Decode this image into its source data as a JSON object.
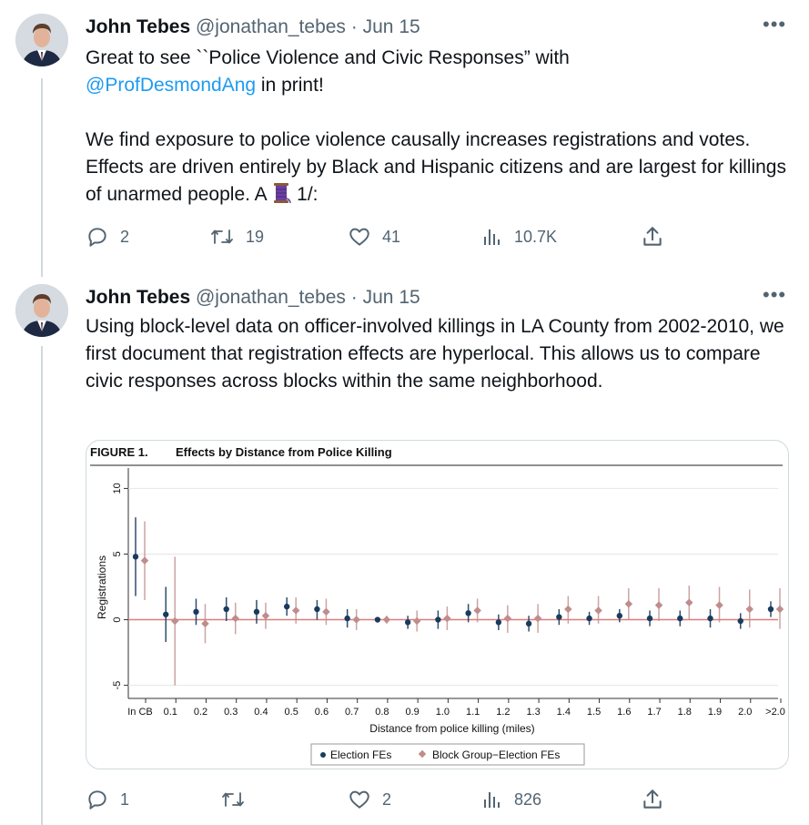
{
  "tweets": [
    {
      "name": "John Tebes",
      "handle": "@jonathan_tebes",
      "separator": "·",
      "date": "Jun 15",
      "text_line1": "Great to see ``Police Violence and Civic Responses” with",
      "mention": "@ProfDesmondAng",
      "text_line2_rest": " in print!",
      "text_para2_a": "We find exposure to police violence causally increases registrations and votes.  Effects are driven entirely by Black and Hispanic citizens and are largest for killings of unarmed people. A ",
      "text_para2_b": " 1/:",
      "replies": "2",
      "retweets": "19",
      "likes": "41",
      "views": "10.7K"
    },
    {
      "name": "John Tebes",
      "handle": "@jonathan_tebes",
      "separator": "·",
      "date": "Jun 15",
      "text": "Using block-level data on officer-involved killings in LA County from 2002-2010, we first document that registration effects are hyperlocal. This allows us to compare civic responses across blocks within the same neighborhood.",
      "replies": "1",
      "retweets": "",
      "likes": "2",
      "views": "826"
    }
  ],
  "icons": {
    "reply": "reply-icon",
    "retweet": "retweet-icon",
    "like": "heart-icon",
    "views": "views-icon",
    "share": "share-icon",
    "more": "more-icon",
    "thread_emoji": "spool-of-thread-emoji"
  },
  "colors": {
    "mention": "#1d9bf0",
    "muted": "#536471",
    "election_fe": "#1a3b5e",
    "block_group_fe": "#c08c8c",
    "zero_line": "#e07b7b"
  },
  "chart_data": {
    "type": "scatter",
    "figure_label": "FIGURE 1.",
    "title": "Effects by Distance from Police Killing",
    "xlabel": "Distance from police killing (miles)",
    "ylabel": "Registrations",
    "ylim": [
      -6,
      11
    ],
    "yticks": [
      "-5",
      "0",
      "5",
      "10"
    ],
    "categories": [
      "In CB",
      "0.1",
      "0.2",
      "0.3",
      "0.4",
      "0.5",
      "0.6",
      "0.7",
      "0.8",
      "0.9",
      "1.0",
      "1.1",
      "1.2",
      "1.3",
      "1.4",
      "1.5",
      "1.6",
      "1.7",
      "1.8",
      "1.9",
      "2.0",
      ">2.0"
    ],
    "series": [
      {
        "name": "Election FEs",
        "values": [
          4.8,
          0.4,
          0.6,
          0.8,
          0.6,
          1.0,
          0.8,
          0.1,
          0.0,
          -0.2,
          0.0,
          0.5,
          -0.2,
          -0.3,
          0.2,
          0.1,
          0.3,
          0.1,
          0.1,
          0.1,
          -0.1,
          0.8
        ],
        "ci_low": [
          1.8,
          -1.7,
          -0.4,
          -0.1,
          -0.3,
          0.3,
          0.0,
          -0.6,
          -0.2,
          -0.7,
          -0.7,
          -0.2,
          -0.8,
          -0.9,
          -0.4,
          -0.4,
          -0.2,
          -0.5,
          -0.5,
          -0.6,
          -0.7,
          0.2
        ],
        "ci_high": [
          7.8,
          2.5,
          1.6,
          1.7,
          1.5,
          1.7,
          1.5,
          0.8,
          0.2,
          0.3,
          0.7,
          1.2,
          0.4,
          0.3,
          0.8,
          0.6,
          0.8,
          0.7,
          0.7,
          0.8,
          0.5,
          1.4
        ]
      },
      {
        "name": "Block Group−Election FEs",
        "values": [
          4.5,
          -0.1,
          -0.3,
          0.1,
          0.3,
          0.7,
          0.6,
          0.0,
          0.0,
          -0.1,
          0.1,
          0.7,
          0.1,
          0.1,
          0.8,
          0.7,
          1.2,
          1.1,
          1.3,
          1.1,
          0.8,
          0.8
        ],
        "ci_low": [
          1.5,
          -5.0,
          -1.8,
          -1.1,
          -0.7,
          -0.3,
          -0.4,
          -0.8,
          -0.3,
          -0.9,
          -0.8,
          -0.2,
          -1.0,
          -1.0,
          -0.3,
          -0.3,
          0.0,
          -0.1,
          0.0,
          -0.2,
          -0.6,
          -0.7
        ],
        "ci_high": [
          7.5,
          4.8,
          1.2,
          1.3,
          1.3,
          1.7,
          1.6,
          0.8,
          0.3,
          0.7,
          1.0,
          1.6,
          1.1,
          1.2,
          1.8,
          1.8,
          2.4,
          2.4,
          2.6,
          2.5,
          2.3,
          2.4
        ]
      }
    ],
    "legend_position": "bottom"
  }
}
